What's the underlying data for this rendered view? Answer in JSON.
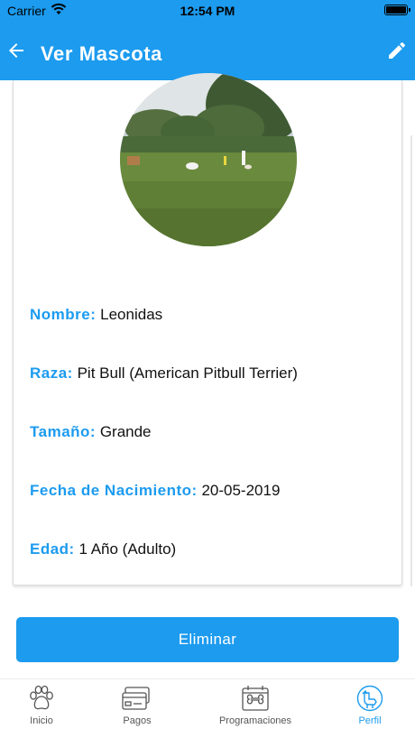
{
  "status": {
    "carrier": "Carrier",
    "time": "12:54 PM"
  },
  "header": {
    "title": "Ver Mascota",
    "back_icon": "arrow-left-icon",
    "edit_icon": "pencil-icon"
  },
  "pet": {
    "photo": "dog-park-photo",
    "fields": [
      {
        "label": "Nombre:",
        "value": "Leonidas"
      },
      {
        "label": "Raza:",
        "value": "Pit Bull (American Pitbull Terrier)"
      },
      {
        "label": "Tamaño:",
        "value": "Grande"
      },
      {
        "label": "Fecha de Nacimiento:",
        "value": "20-05-2019"
      },
      {
        "label": "Edad:",
        "value": "1 Año (Adulto)"
      }
    ]
  },
  "actions": {
    "delete_label": "Eliminar"
  },
  "tabs": [
    {
      "label": "Inicio",
      "icon": "paw-icon"
    },
    {
      "label": "Pagos",
      "icon": "credit-card-icon"
    },
    {
      "label": "Programaciones",
      "icon": "bone-calendar-icon"
    },
    {
      "label": "Perfil",
      "icon": "pet-profile-icon",
      "active": true
    }
  ],
  "colors": {
    "accent": "#1c9bef",
    "text": "#111111",
    "tab_inactive": "#555555"
  }
}
